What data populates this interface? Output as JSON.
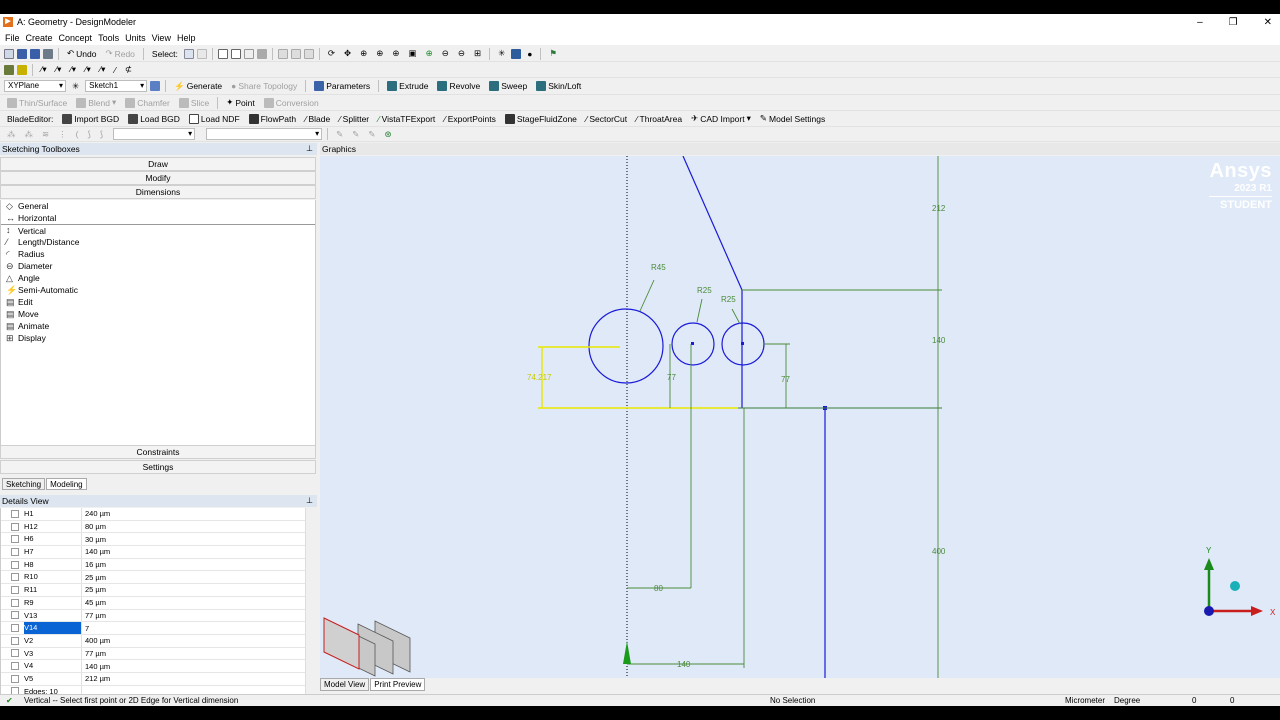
{
  "window": {
    "title": "A: Geometry - DesignModeler",
    "app_icon": "ansys-icon",
    "controls": [
      "–",
      "❐",
      "✕"
    ]
  },
  "menu": [
    "File",
    "Create",
    "Concept",
    "Tools",
    "Units",
    "View",
    "Help"
  ],
  "toolbar1": {
    "undo": "Undo",
    "redo": "Redo",
    "select": "Select:"
  },
  "toolbar3": {
    "plane": "XYPlane",
    "sketch": "Sketch1",
    "generate": "Generate",
    "share_topology": "Share Topology",
    "parameters": "Parameters",
    "extrude": "Extrude",
    "revolve": "Revolve",
    "sweep": "Sweep",
    "skin_loft": "Skin/Loft"
  },
  "toolbar4": {
    "thin_surface": "Thin/Surface",
    "blend": "Blend",
    "chamfer": "Chamfer",
    "slice": "Slice",
    "point": "Point",
    "conversion": "Conversion"
  },
  "toolbar5": {
    "blade_editor": "BladeEditor:",
    "import_bgd": "Import BGD",
    "load_bgd": "Load BGD",
    "load_ndf": "Load NDF",
    "flowpath": "FlowPath",
    "blade": "Blade",
    "splitter": "Splitter",
    "vistatf": "VistaTFExport",
    "exportpoints": "ExportPoints",
    "stagefluid": "StageFluidZone",
    "sectorcut": "SectorCut",
    "throatarea": "ThroatArea",
    "cad_import": "CAD Import",
    "model_settings": "Model Settings"
  },
  "sketching": {
    "header": "Sketching Toolboxes",
    "draw": "Draw",
    "modify": "Modify",
    "dimensions": "Dimensions",
    "constraints": "Constraints",
    "settings": "Settings",
    "items": [
      "General",
      "Horizontal",
      "Vertical",
      "Length/Distance",
      "Radius",
      "Diameter",
      "Angle",
      "Semi-Automatic",
      "Edit",
      "Move",
      "Animate",
      "Display"
    ]
  },
  "left_tabs": [
    "Sketching",
    "Modeling"
  ],
  "details": {
    "header": "Details View",
    "rows": [
      [
        "H1",
        "240 µm"
      ],
      [
        "H12",
        "80 µm"
      ],
      [
        "H6",
        "30 µm"
      ],
      [
        "H7",
        "140 µm"
      ],
      [
        "H8",
        "16 µm"
      ],
      [
        "R10",
        "25 µm"
      ],
      [
        "R11",
        "25 µm"
      ],
      [
        "R9",
        "45 µm"
      ],
      [
        "V13",
        "77 µm"
      ],
      [
        "V14",
        "7"
      ],
      [
        "V2",
        "400 µm"
      ],
      [
        "V3",
        "77 µm"
      ],
      [
        "V4",
        "140 µm"
      ],
      [
        "V5",
        "212 µm"
      ],
      [
        "Edges: 10",
        ""
      ]
    ]
  },
  "graphics": {
    "header": "Graphics",
    "brand1": "Ansys",
    "brand2": "2023 R1",
    "brand3": "STUDENT",
    "dims": {
      "d212": "212",
      "d140v": "140",
      "d400": "400",
      "r45": "R45",
      "r25a": "R25",
      "r25b": "R25",
      "d74": "74.217",
      "d77a": "77",
      "d77b": "77",
      "d80": "80",
      "d140h": "140"
    },
    "axis_y": "Y",
    "axis_x": "X"
  },
  "bottom_tabs": [
    "Model View",
    "Print Preview"
  ],
  "status": {
    "message": "Vertical -- Select first point or 2D Edge for Vertical dimension",
    "selection": "No Selection",
    "units": "Micrometer",
    "angle": "Degree",
    "v1": "0",
    "v2": "0"
  }
}
